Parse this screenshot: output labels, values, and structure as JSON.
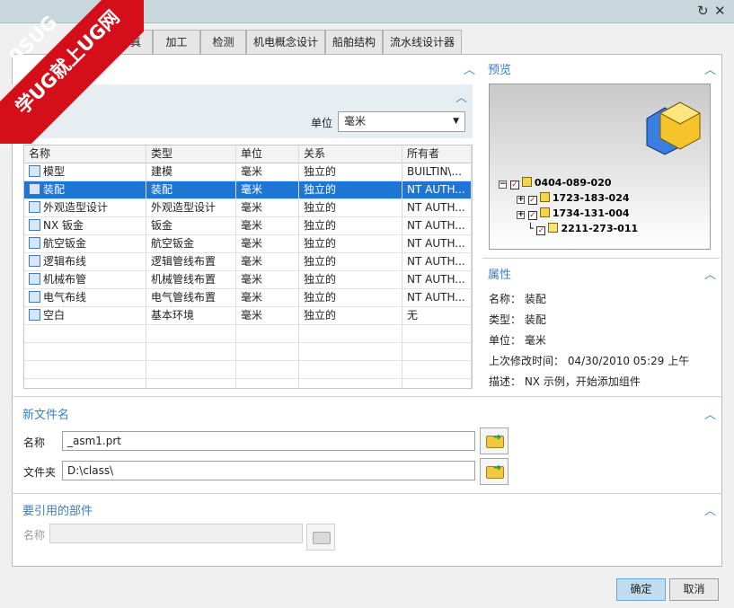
{
  "window": {
    "refresh_icon": "↻",
    "close_icon": "✕"
  },
  "watermark": {
    "line1": "9SUG",
    "line2": "学UG就上UG网"
  },
  "tabs": [
    "仿真",
    "加工",
    "检测",
    "机电概念设计",
    "船舶结构",
    "流水线设计器"
  ],
  "filter": {
    "title": "过滤器",
    "unit_label": "单位",
    "unit_value": "毫米"
  },
  "table": {
    "headers": [
      "名称",
      "类型",
      "单位",
      "关系",
      "所有者"
    ],
    "rows": [
      [
        "模型",
        "建模",
        "毫米",
        "独立的",
        "BUILTIN\\..."
      ],
      [
        "装配",
        "装配",
        "毫米",
        "独立的",
        "NT AUTH..."
      ],
      [
        "外观造型设计",
        "外观造型设计",
        "毫米",
        "独立的",
        "NT AUTH..."
      ],
      [
        "NX 钣金",
        "钣金",
        "毫米",
        "独立的",
        "NT AUTH..."
      ],
      [
        "航空钣金",
        "航空钣金",
        "毫米",
        "独立的",
        "NT AUTH..."
      ],
      [
        "逻辑布线",
        "逻辑管线布置",
        "毫米",
        "独立的",
        "NT AUTH..."
      ],
      [
        "机械布管",
        "机械管线布置",
        "毫米",
        "独立的",
        "NT AUTH..."
      ],
      [
        "电气布线",
        "电气管线布置",
        "毫米",
        "独立的",
        "NT AUTH..."
      ],
      [
        "空白",
        "基本环境",
        "毫米",
        "独立的",
        "无"
      ]
    ],
    "selected_index": 1
  },
  "preview": {
    "title": "预览",
    "tree": [
      "0404-089-020",
      "1723-183-024",
      "1734-131-004",
      "2211-273-011"
    ]
  },
  "properties": {
    "title": "属性",
    "name": "名称： 装配",
    "type": "类型： 装配",
    "unit": "单位： 毫米",
    "modified": "上次修改时间： 04/30/2010 05:29 上午",
    "desc": "描述： NX 示例，开始添加组件"
  },
  "newfile": {
    "title": "新文件名",
    "name_label": "名称",
    "name_value": "_asm1.prt",
    "folder_label": "文件夹",
    "folder_value": "D:\\class\\"
  },
  "ref": {
    "title": "要引用的部件",
    "name_label": "名称",
    "name_value": ""
  },
  "buttons": {
    "ok": "确定",
    "cancel": "取消"
  }
}
